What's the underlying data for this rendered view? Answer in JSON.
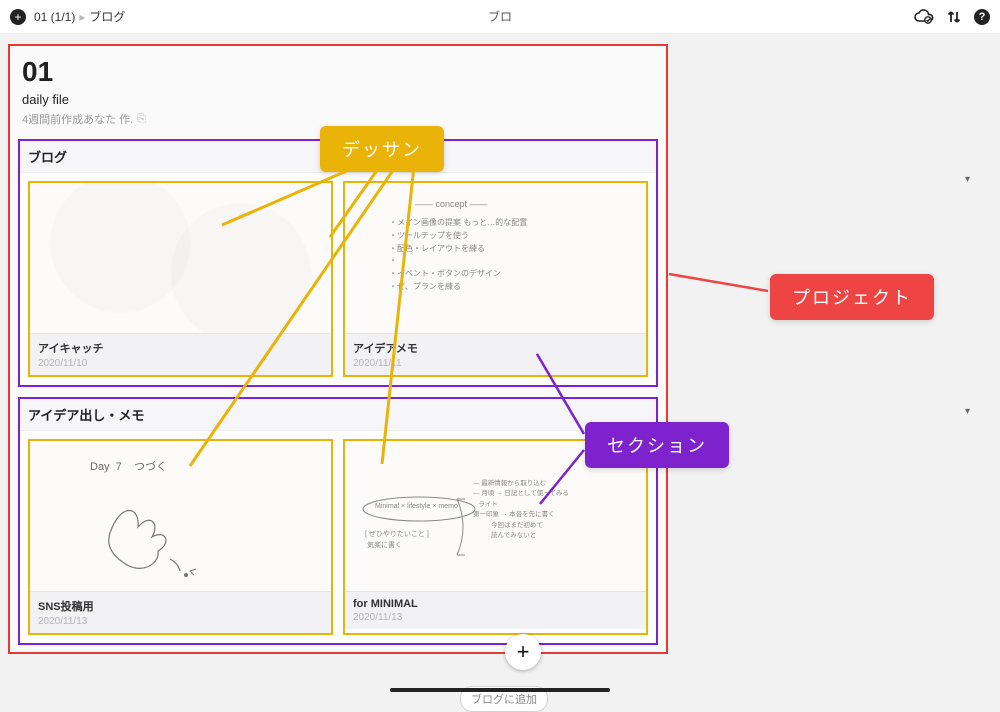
{
  "topbar": {
    "breadcrumb_project": "01 (1/1)",
    "breadcrumb_sep": "▸",
    "breadcrumb_section": "ブログ",
    "center_text": "ブロ"
  },
  "project": {
    "number": "01",
    "subtitle": "daily file",
    "meta": "4週間前作成あなた 作.",
    "link_glyph": "⎘"
  },
  "sections": [
    {
      "title": "ブログ",
      "cards": [
        {
          "name": "アイキャッチ",
          "date": "2020/11/10"
        },
        {
          "name": "アイデアメモ",
          "date": "2020/11/11"
        }
      ]
    },
    {
      "title": "アイデア出し・メモ",
      "cards": [
        {
          "name": "SNS投稿用",
          "date": "2020/11/13"
        },
        {
          "name": "for MINIMAL",
          "date": "2020/11/13"
        }
      ]
    }
  ],
  "annotations": {
    "dessan": "デッサン",
    "project": "プロジェクト",
    "section": "セクション"
  },
  "bottom": {
    "chip": "ブログに追加",
    "plus": "+"
  },
  "dropdown_caret": "▾",
  "sketch": {
    "day7": "Day  7    つづく",
    "memo1": "・メイン画像の提案 もっと…的な配置\n・ツールチップを使う\n・配色・レイアウトを練る\n・\n・イベント・ボタンのデザイン\n・ぜ、プランを練る",
    "memo1_title": "—— concept ——",
    "memo2_center": "Minimal × lifestyle × memo",
    "memo2_left": "[ ぜひやりたいこと ]\n 気楽に書く",
    "memo2_right": "— 最新情報から取り込む\n— 月頃 → 日記として使ってみる\n   ライト\n第一印象 → 本音を先に書く\n          今回はまだ初めて\n          読んでみないと"
  }
}
